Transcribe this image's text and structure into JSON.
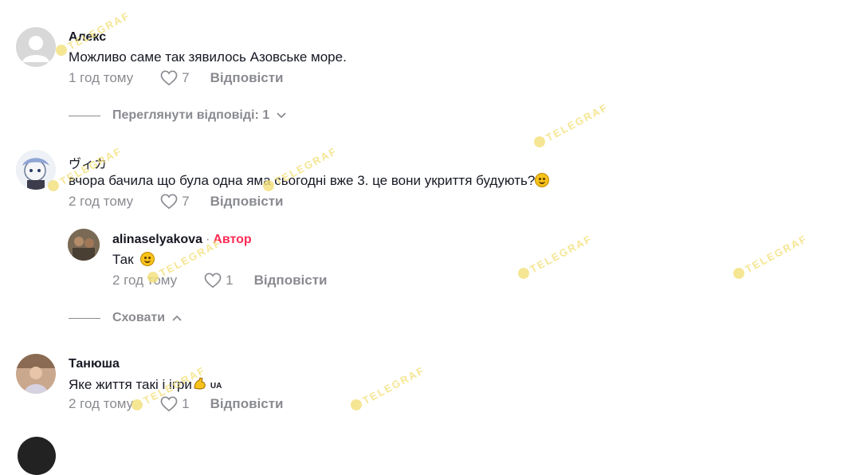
{
  "comments": [
    {
      "author": "Алекс",
      "text": "Можливо саме так зявилось Азовське море.",
      "time": "1 год тому",
      "likes": "7",
      "reply_label": "Відповісти",
      "avatar_icon": "default-avatar-icon"
    },
    {
      "author": "ヴィカ",
      "text": "вчора бачила що була одна яма сьогодні вже 3. це вони укриття будують?",
      "time": "2 год тому",
      "likes": "7",
      "reply_label": "Відповісти",
      "emoji_icon": "grinning-sweat-emoji-icon",
      "reply": {
        "author": "alinaselyakova",
        "author_badge": "Автор",
        "separator": "·",
        "text": "Так",
        "time": "2 год тому",
        "likes": "1",
        "reply_label": "Відповісти",
        "emoji_icon": "grinning-emoji-icon"
      }
    },
    {
      "author": "Танюша",
      "text": "Яке життя такі і ігри",
      "flag_text": "UA",
      "time": "2 год тому",
      "likes": "1",
      "reply_label": "Відповісти",
      "emoji_icon": "flexed-biceps-emoji-icon"
    }
  ],
  "view_replies": {
    "label": "Переглянути відповіді: 1",
    "icon": "chevron-down-icon"
  },
  "hide_replies": {
    "label": "Сховати",
    "icon": "chevron-up-icon"
  },
  "watermark_text": "TELEGRAF",
  "colors": {
    "text": "#161823",
    "muted": "#8a8b91",
    "author_badge": "#fe2c55",
    "watermark": "#f3e07a"
  }
}
